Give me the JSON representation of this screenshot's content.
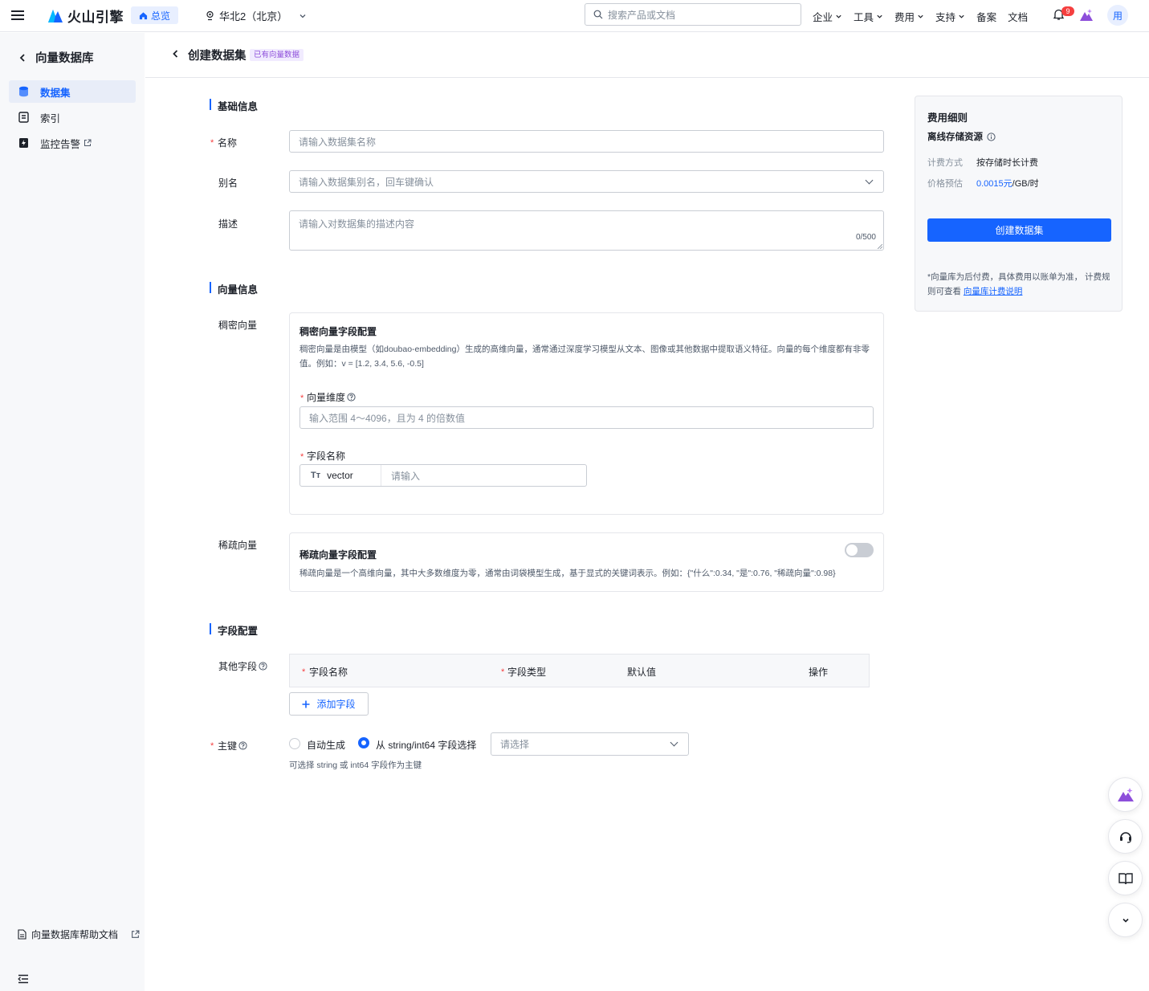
{
  "topbar": {
    "brand": "火山引擎",
    "overview": "总览",
    "region": "华北2（北京）",
    "search_placeholder": "搜索产品或文档",
    "nav": [
      "企业",
      "工具",
      "费用",
      "支持",
      "备案",
      "文档"
    ],
    "notification_count": "9",
    "avatar_text": "用"
  },
  "sidebar": {
    "title": "向量数据库",
    "items": [
      {
        "label": "数据集"
      },
      {
        "label": "索引"
      },
      {
        "label": "监控告警"
      }
    ],
    "help": "向量数据库帮助文档"
  },
  "header": {
    "title": "创建数据集",
    "tag": "已有向量数据"
  },
  "basic": {
    "section": "基础信息",
    "name_label": "名称",
    "name_placeholder": "请输入数据集名称",
    "alias_label": "别名",
    "alias_placeholder": "请输入数据集别名，回车键确认",
    "desc_label": "描述",
    "desc_placeholder": "请输入对数据集的描述内容",
    "desc_count": "0/500"
  },
  "vector": {
    "section": "向量信息",
    "dense_label": "稠密向量",
    "dense_title": "稠密向量字段配置",
    "dense_desc": "稠密向量是由模型（如doubao-embedding）生成的高维向量，通常通过深度学习模型从文本、图像或其他数据中提取语义特征。向量的每个维度都有非零值。例如：v = [1.2, 3.4, 5.6, -0.5]",
    "dim_label": "向量维度",
    "dim_placeholder": "输入范围 4～4096，且为 4 的倍数值",
    "field_label": "字段名称",
    "field_type": "vector",
    "field_placeholder": "请输入",
    "sparse_label": "稀疏向量",
    "sparse_title": "稀疏向量字段配置",
    "sparse_desc": "稀疏向量是一个高维向量，其中大多数维度为零，通常由词袋模型生成，基于显式的关键词表示。例如：{\"什么\":0.34, \"是\":0.76, \"稀疏向量\":0.98}"
  },
  "fields": {
    "section": "字段配置",
    "other_label": "其他字段",
    "columns": [
      "字段名称",
      "字段类型",
      "默认值",
      "操作"
    ],
    "add_button": "添加字段",
    "pk_label": "主键",
    "pk_option_auto": "自动生成",
    "pk_option_select": "从 string/int64 字段选择",
    "pk_select_placeholder": "请选择",
    "pk_hint": "可选择 string 或 int64 字段作为主键"
  },
  "fee": {
    "title": "费用细则",
    "subtitle": "离线存储资源",
    "billing_key": "计费方式",
    "billing_val": "按存储时长计费",
    "price_key": "价格预估",
    "price_val": "0.0015元",
    "price_unit": "/GB/时",
    "create_button": "创建数据集",
    "note": "*向量库为后付费，具体费用以账单为准， 计费规则可查看",
    "note_link": "向量库计费说明"
  }
}
